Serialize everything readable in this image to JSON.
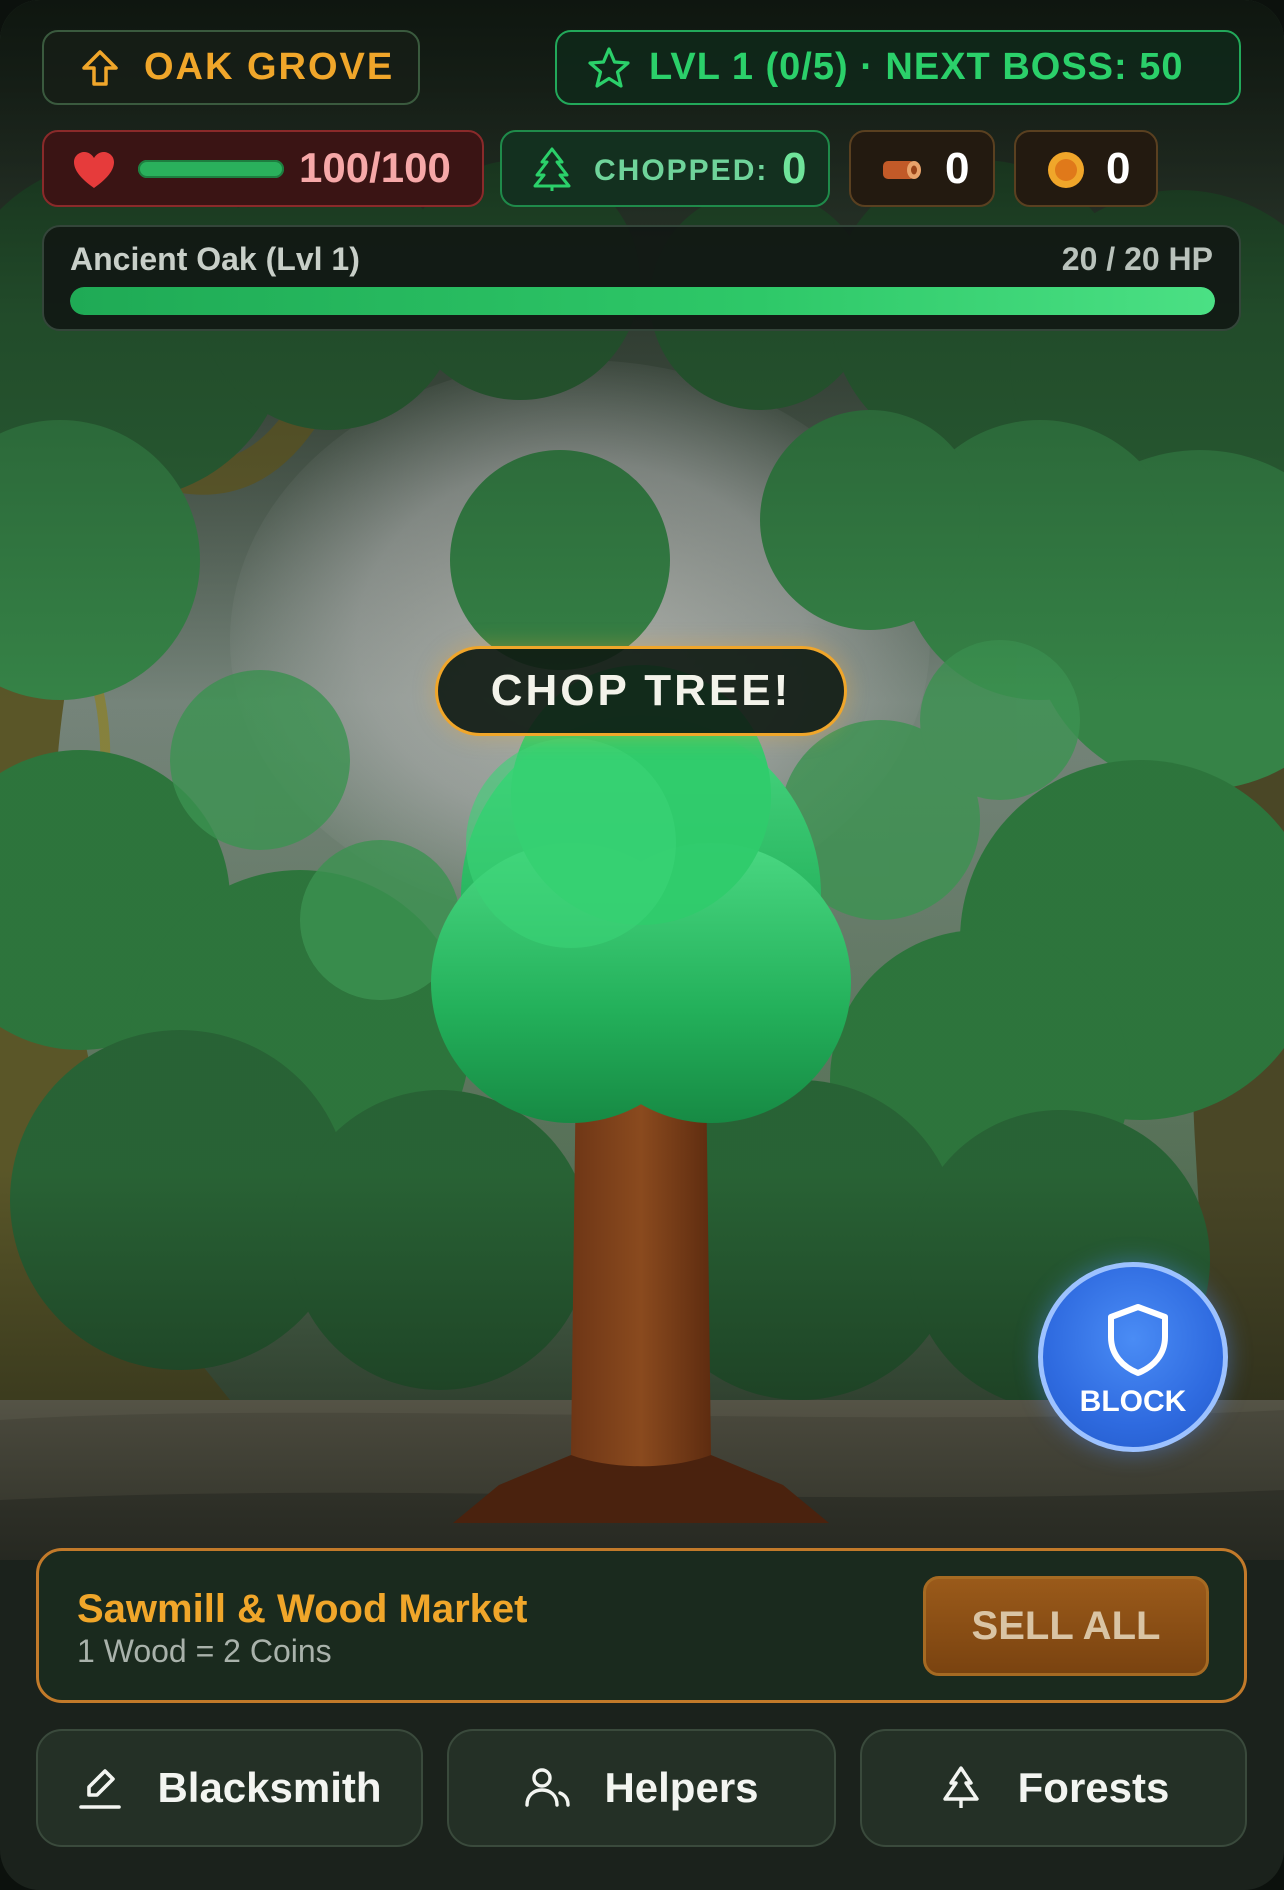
{
  "header": {
    "location": "OAK GROVE",
    "level_text": "LVL 1 (0/5) · NEXT BOSS: 50"
  },
  "stats": {
    "health": {
      "value": "100/100",
      "fill": 1.0
    },
    "chopped": {
      "label": "CHOPPED:",
      "value": "0"
    },
    "wood": {
      "value": "0"
    },
    "coins": {
      "value": "0"
    }
  },
  "target": {
    "name": "Ancient Oak (Lvl 1)",
    "hp_text": "20 / 20 HP",
    "hp_fraction": 1.0
  },
  "actions": {
    "chop_label": "CHOP TREE!",
    "block_label": "BLOCK"
  },
  "market": {
    "title": "Sawmill & Wood Market",
    "rate": "1 Wood = 2 Coins",
    "sell_label": "SELL ALL"
  },
  "nav": {
    "blacksmith": "Blacksmith",
    "helpers": "Helpers",
    "forests": "Forests"
  },
  "colors": {
    "accent_orange": "#f0a62a",
    "accent_green": "#2bd06a",
    "health_red": "#e63b3b",
    "block_blue": "#2f6be0"
  },
  "icons": {
    "location": "arrow-up-icon",
    "level": "star-icon",
    "health": "heart-icon",
    "chopped": "pine-tree-icon",
    "wood": "log-icon",
    "coins": "coin-icon",
    "block": "shield-icon",
    "blacksmith": "hammer-icon",
    "helpers": "users-icon",
    "forests": "tree-icon"
  }
}
